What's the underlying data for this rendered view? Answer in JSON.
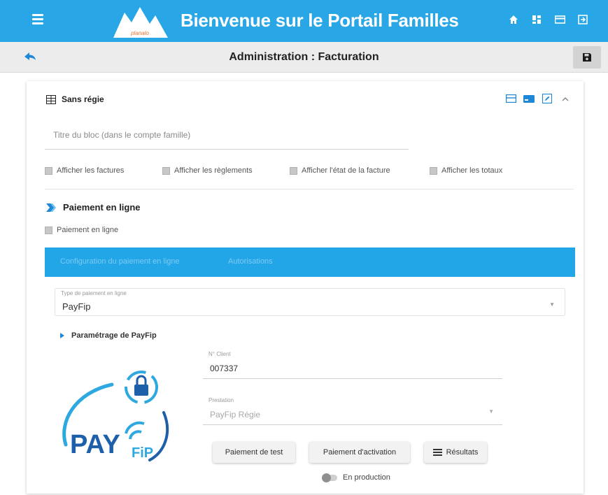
{
  "app": {
    "title": "Bienvenue sur le Portail Familles",
    "logo_text": "planalo"
  },
  "topbar": {
    "icons": [
      "menu-icon",
      "home-icon",
      "dashboard-icon",
      "card-icon",
      "logout-icon"
    ]
  },
  "header": {
    "page_title": "Administration : Facturation"
  },
  "block": {
    "title": "Sans régie",
    "title_field_placeholder": "Titre du bloc (dans le compte famille)",
    "checkboxes": [
      "Afficher les factures",
      "Afficher les règlements",
      "Afficher l'état de la facture",
      "Afficher les totaux"
    ]
  },
  "online_payment": {
    "section_title": "Paiement en ligne",
    "checkbox_label": "Paiement en ligne",
    "tabs": [
      "Configuration du paiement en ligne",
      "Autorisations"
    ],
    "type_label": "Type de paiement en ligne",
    "type_value": "PayFip",
    "settings_title": "Paramétrage de PayFip",
    "client_label": "N° Client",
    "client_value": "007337",
    "prestation_label": "Prestation",
    "prestation_value": "PayFip Régie",
    "buttons": {
      "test": "Paiement de test",
      "activation": "Paiement d'activation",
      "results": "Résultats"
    },
    "production_label": "En production",
    "production_on": false
  },
  "colors": {
    "primary": "#29a6e6",
    "tab_bar": "#22a6e8",
    "payfip_blue": "#1d5fa8",
    "payfip_light": "#2ea8e0"
  }
}
